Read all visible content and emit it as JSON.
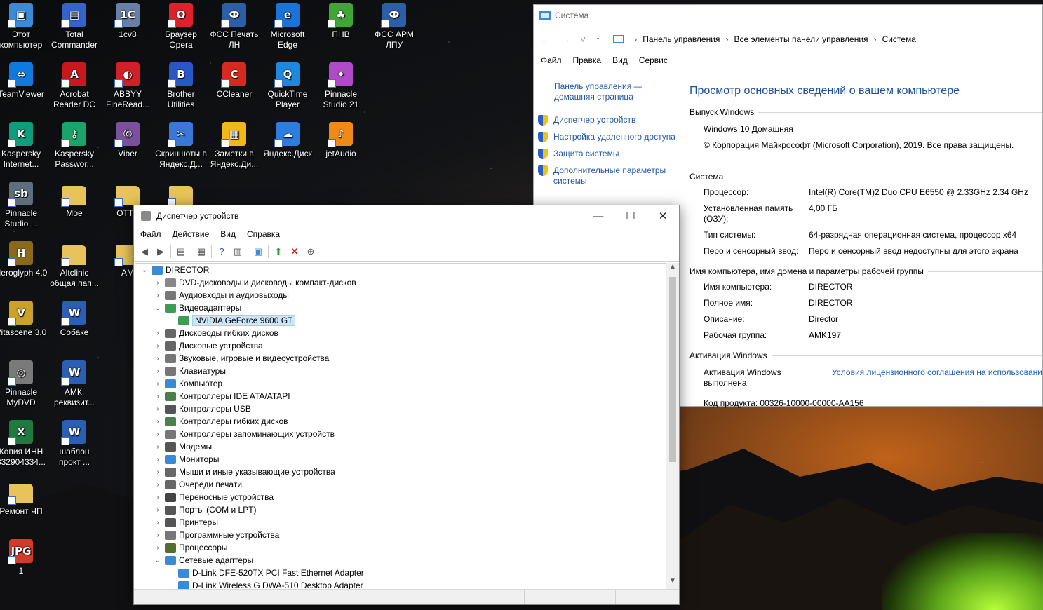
{
  "desktop": {
    "icons": [
      {
        "label": "Этот компьютер",
        "icon": "monitor-icon",
        "color": "#3a8ad6",
        "glyph": "▣",
        "col": 0,
        "row": 0
      },
      {
        "label": "Total Commander",
        "icon": "floppy-icon",
        "color": "#3563c9",
        "glyph": "▤",
        "col": 1,
        "row": 0
      },
      {
        "label": "1cv8",
        "icon": "computer-icon",
        "color": "#6a7fa6",
        "glyph": "1C",
        "col": 2,
        "row": 0
      },
      {
        "label": "Браузер Opera",
        "icon": "opera-icon",
        "color": "#e0202a",
        "glyph": "O",
        "col": 3,
        "row": 0
      },
      {
        "label": "ФСС Печать ЛН",
        "icon": "fss-icon",
        "color": "#2d5fa8",
        "glyph": "Ф",
        "col": 4,
        "row": 0
      },
      {
        "label": "Microsoft Edge",
        "icon": "edge-icon",
        "color": "#1a73d9",
        "glyph": "e",
        "col": 5,
        "row": 0
      },
      {
        "label": "ПНВ",
        "icon": "tree-icon",
        "color": "#3fa535",
        "glyph": "♣",
        "col": 6,
        "row": 0
      },
      {
        "label": "ФСС АРМ ЛПУ",
        "icon": "fss-icon",
        "color": "#2d5fa8",
        "glyph": "Ф",
        "col": 7,
        "row": 0
      },
      {
        "label": "TeamViewer",
        "icon": "teamviewer-icon",
        "color": "#0e7ae0",
        "glyph": "⇔",
        "col": 0,
        "row": 1
      },
      {
        "label": "Acrobat Reader DC",
        "icon": "acrobat-icon",
        "color": "#c8181e",
        "glyph": "A",
        "col": 1,
        "row": 1
      },
      {
        "label": "ABBYY FineRead...",
        "icon": "abbyy-icon",
        "color": "#d22028",
        "glyph": "◐",
        "col": 2,
        "row": 1
      },
      {
        "label": "Brother Utilities",
        "icon": "brother-icon",
        "color": "#2a56c6",
        "glyph": "B",
        "col": 3,
        "row": 1
      },
      {
        "label": "CCleaner",
        "icon": "ccleaner-icon",
        "color": "#d42a1f",
        "glyph": "C",
        "col": 4,
        "row": 1
      },
      {
        "label": "QuickTime Player",
        "icon": "quicktime-icon",
        "color": "#1d88e0",
        "glyph": "Q",
        "col": 5,
        "row": 1
      },
      {
        "label": "Pinnacle Studio 21",
        "icon": "pinnacle-icon",
        "color": "#b04bc8",
        "glyph": "✦",
        "col": 6,
        "row": 1
      },
      {
        "label": "Kaspersky Internet...",
        "icon": "kaspersky-icon",
        "color": "#0f9d7a",
        "glyph": "K",
        "col": 0,
        "row": 2
      },
      {
        "label": "Kaspersky Passwor...",
        "icon": "kaspersky-key-icon",
        "color": "#1aa36b",
        "glyph": "⚷",
        "col": 1,
        "row": 2
      },
      {
        "label": "Viber",
        "icon": "viber-icon",
        "color": "#7b519d",
        "glyph": "✆",
        "col": 2,
        "row": 2
      },
      {
        "label": "Скриншоты в Яндекс.Д...",
        "icon": "screenshot-icon",
        "color": "#3a78d8",
        "glyph": "✂",
        "col": 3,
        "row": 2
      },
      {
        "label": "Заметки в Яндекс.Ди...",
        "icon": "notes-icon",
        "color": "#f2b818",
        "glyph": "▦",
        "col": 4,
        "row": 2
      },
      {
        "label": "Яндекс.Диск",
        "icon": "yandex-disk-icon",
        "color": "#2b7de0",
        "glyph": "☁",
        "col": 5,
        "row": 2
      },
      {
        "label": "jetAudio",
        "icon": "jetaudio-icon",
        "color": "#f08a16",
        "glyph": "♪",
        "col": 6,
        "row": 2
      },
      {
        "label": "Pinnacle Studio ...",
        "icon": "pinnacle-sb-icon",
        "color": "#5f6e7c",
        "glyph": "sb",
        "col": 0,
        "row": 3
      },
      {
        "label": "Мое",
        "icon": "folder-icon",
        "color": "#e8c35a",
        "glyph": "",
        "col": 1,
        "row": 3
      },
      {
        "label": "ОТТУ",
        "icon": "folder-icon",
        "color": "#e8c35a",
        "glyph": "",
        "col": 2,
        "row": 3
      },
      {
        "label": "",
        "icon": "folder-icon",
        "color": "#e8c35a",
        "glyph": "",
        "col": 3,
        "row": 3
      },
      {
        "label": "Heroglyph 4.0",
        "icon": "heroglyph-icon",
        "color": "#8a6a1a",
        "glyph": "H",
        "col": 0,
        "row": 4
      },
      {
        "label": "Altclinic общая пап...",
        "icon": "folder-icon",
        "color": "#e8c35a",
        "glyph": "",
        "col": 1,
        "row": 4
      },
      {
        "label": "АМ",
        "icon": "folder-icon",
        "color": "#e8c35a",
        "glyph": "",
        "col": 2,
        "row": 4
      },
      {
        "label": "Vitascene 3.0",
        "icon": "vitascene-icon",
        "color": "#caa22a",
        "glyph": "V",
        "col": 0,
        "row": 5
      },
      {
        "label": "Собаке",
        "icon": "word-doc-icon",
        "color": "#2b5fb3",
        "glyph": "W",
        "col": 1,
        "row": 5
      },
      {
        "label": "Pinnacle MyDVD",
        "icon": "dvd-icon",
        "color": "#7a7a7a",
        "glyph": "◎",
        "col": 0,
        "row": 6
      },
      {
        "label": "АМК, реквизит...",
        "icon": "word-doc-icon",
        "color": "#2b5fb3",
        "glyph": "W",
        "col": 1,
        "row": 6
      },
      {
        "label": "Копия ИНН 332904334...",
        "icon": "excel-doc-icon",
        "color": "#1f7a3f",
        "glyph": "X",
        "col": 0,
        "row": 7
      },
      {
        "label": "шаблон прокт ...",
        "icon": "word-doc-icon",
        "color": "#2b5fb3",
        "glyph": "W",
        "col": 1,
        "row": 7
      },
      {
        "label": "Ремонт ЧП",
        "icon": "folder-icon",
        "color": "#e8c35a",
        "glyph": "",
        "col": 0,
        "row": 8
      },
      {
        "label": "1",
        "icon": "jpg-file-icon",
        "color": "#d23a2a",
        "glyph": "JPG",
        "col": 0,
        "row": 9
      }
    ]
  },
  "system_window": {
    "title": "Система",
    "breadcrumb": [
      "Панель управления",
      "Все элементы панели управления",
      "Система"
    ],
    "menu": [
      "Файл",
      "Правка",
      "Вид",
      "Сервис"
    ],
    "sidebar_home": "Панель управления — домашняя страница",
    "sidebar_links": [
      "Диспетчер устройств",
      "Настройка удаленного доступа",
      "Защита системы",
      "Дополнительные параметры системы"
    ],
    "heading": "Просмотр основных сведений о вашем компьютере",
    "edition_title": "Выпуск Windows",
    "edition": "Windows 10 Домашняя",
    "copyright": "© Корпорация Майкрософт (Microsoft Corporation), 2019. Все права защищены.",
    "system_title": "Система",
    "system_rows": [
      {
        "k": "Процессор:",
        "v": "Intel(R) Core(TM)2 Duo CPU     E6550  @ 2.33GHz   2.34 GHz"
      },
      {
        "k": "Установленная память (ОЗУ):",
        "v": "4,00 ГБ"
      },
      {
        "k": "Тип системы:",
        "v": "64-разрядная операционная система, процессор x64"
      },
      {
        "k": "Перо и сенсорный ввод:",
        "v": "Перо и сенсорный ввод недоступны для этого экрана"
      }
    ],
    "name_title": "Имя компьютера, имя домена и параметры рабочей группы",
    "name_rows": [
      {
        "k": "Имя компьютера:",
        "v": "DIRECTOR"
      },
      {
        "k": "Полное имя:",
        "v": "DIRECTOR"
      },
      {
        "k": "Описание:",
        "v": "Director"
      },
      {
        "k": "Рабочая группа:",
        "v": "AMK197"
      }
    ],
    "activation_title": "Активация Windows",
    "activation_status": "Активация Windows выполнена",
    "license_link": "Условия лицензионного соглашения на использовани",
    "product_key": "Код продукта:  00326-10000-00000-AA156"
  },
  "device_manager": {
    "title": "Диспетчер устройств",
    "menu": [
      "Файл",
      "Действие",
      "Вид",
      "Справка"
    ],
    "tree": [
      {
        "label": "DIRECTOR",
        "level": 0,
        "exp": "open",
        "icon": "computer-icon",
        "color": "#3a8ad6"
      },
      {
        "label": "DVD-дисководы и дисководы компакт-дисков",
        "level": 1,
        "exp": "closed",
        "icon": "dvd-drive-icon",
        "color": "#888888"
      },
      {
        "label": "Аудиовходы и аудиовыходы",
        "level": 1,
        "exp": "closed",
        "icon": "speaker-icon",
        "color": "#777777"
      },
      {
        "label": "Видеоадаптеры",
        "level": 1,
        "exp": "open",
        "icon": "display-adapter-icon",
        "color": "#3f9a56"
      },
      {
        "label": "NVIDIA GeForce 9600 GT",
        "level": 2,
        "exp": "none",
        "icon": "display-adapter-icon",
        "color": "#3f9a56",
        "selected": true
      },
      {
        "label": "Дисководы гибких дисков",
        "level": 1,
        "exp": "closed",
        "icon": "floppy-drive-icon",
        "color": "#666666"
      },
      {
        "label": "Дисковые устройства",
        "level": 1,
        "exp": "closed",
        "icon": "disk-drive-icon",
        "color": "#666666"
      },
      {
        "label": "Звуковые, игровые и видеоустройства",
        "level": 1,
        "exp": "closed",
        "icon": "sound-icon",
        "color": "#777777"
      },
      {
        "label": "Клавиатуры",
        "level": 1,
        "exp": "closed",
        "icon": "keyboard-icon",
        "color": "#777777"
      },
      {
        "label": "Компьютер",
        "level": 1,
        "exp": "closed",
        "icon": "monitor-icon",
        "color": "#3a8ad6"
      },
      {
        "label": "Контроллеры IDE ATA/ATAPI",
        "level": 1,
        "exp": "closed",
        "icon": "ide-controller-icon",
        "color": "#4d7f4d"
      },
      {
        "label": "Контроллеры USB",
        "level": 1,
        "exp": "closed",
        "icon": "usb-icon",
        "color": "#555555"
      },
      {
        "label": "Контроллеры гибких дисков",
        "level": 1,
        "exp": "closed",
        "icon": "controller-icon",
        "color": "#4d7f4d"
      },
      {
        "label": "Контроллеры запоминающих устройств",
        "level": 1,
        "exp": "closed",
        "icon": "storage-controller-icon",
        "color": "#777777"
      },
      {
        "label": "Модемы",
        "level": 1,
        "exp": "closed",
        "icon": "modem-icon",
        "color": "#555555"
      },
      {
        "label": "Мониторы",
        "level": 1,
        "exp": "closed",
        "icon": "monitor-icon",
        "color": "#3a8ad6"
      },
      {
        "label": "Мыши и иные указывающие устройства",
        "level": 1,
        "exp": "closed",
        "icon": "mouse-icon",
        "color": "#666666"
      },
      {
        "label": "Очереди печати",
        "level": 1,
        "exp": "closed",
        "icon": "print-queue-icon",
        "color": "#666666"
      },
      {
        "label": "Переносные устройства",
        "level": 1,
        "exp": "closed",
        "icon": "portable-device-icon",
        "color": "#444444"
      },
      {
        "label": "Порты (COM и LPT)",
        "level": 1,
        "exp": "closed",
        "icon": "port-icon",
        "color": "#555555"
      },
      {
        "label": "Принтеры",
        "level": 1,
        "exp": "closed",
        "icon": "printer-icon",
        "color": "#555555"
      },
      {
        "label": "Программные устройства",
        "level": 1,
        "exp": "closed",
        "icon": "software-device-icon",
        "color": "#777777"
      },
      {
        "label": "Процессоры",
        "level": 1,
        "exp": "closed",
        "icon": "cpu-icon",
        "color": "#556b2f"
      },
      {
        "label": "Сетевые адаптеры",
        "level": 1,
        "exp": "open",
        "icon": "network-adapter-icon",
        "color": "#3a8ad6"
      },
      {
        "label": "D-Link DFE-520TX PCI Fast Ethernet Adapter",
        "level": 2,
        "exp": "none",
        "icon": "network-adapter-icon",
        "color": "#3a8ad6"
      },
      {
        "label": "D-Link Wireless G DWA-510 Desktop Adapter",
        "level": 2,
        "exp": "none",
        "icon": "network-adapter-icon",
        "color": "#3a8ad6"
      }
    ]
  }
}
